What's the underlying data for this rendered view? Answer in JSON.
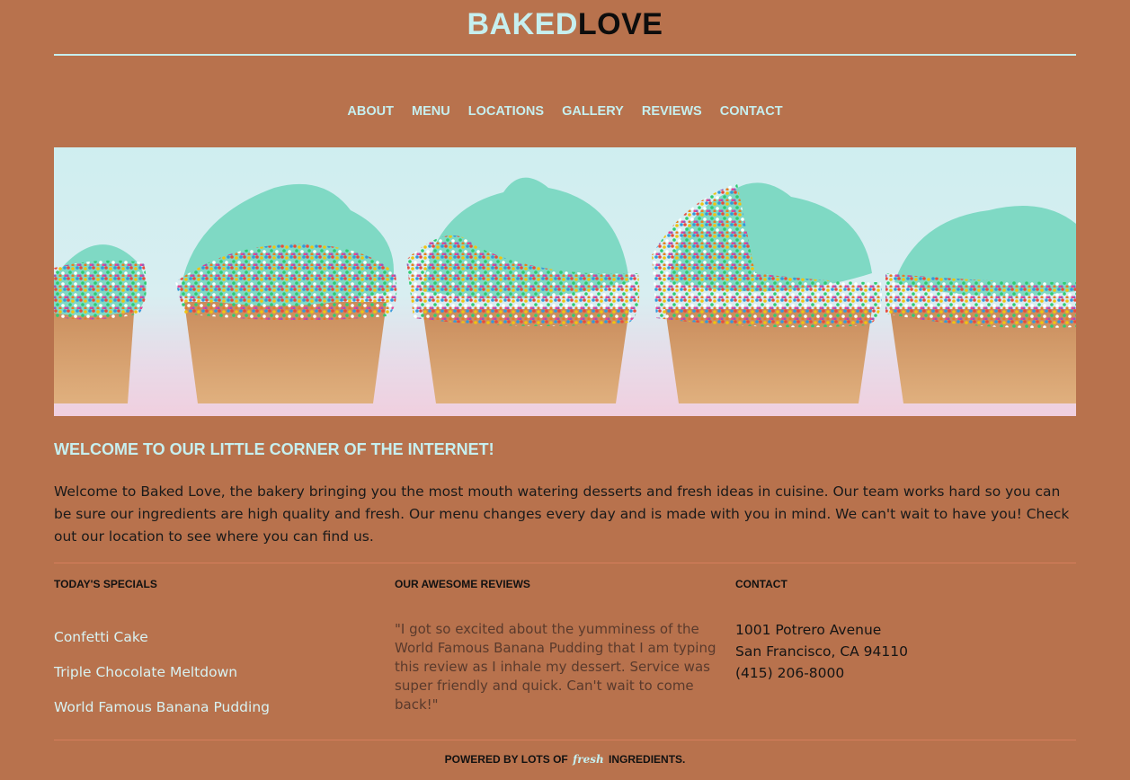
{
  "header": {
    "logo_part1": "BAKED",
    "logo_part2": "LOVE"
  },
  "nav": {
    "items": [
      "ABOUT",
      "MENU",
      "LOCATIONS",
      "GALLERY",
      "REVIEWS",
      "CONTACT"
    ]
  },
  "main": {
    "welcome_title": "WELCOME TO OUR LITTLE CORNER OF THE INTERNET!",
    "welcome_text": "Welcome to Baked Love, the bakery bringing you the most mouth watering desserts and fresh ideas in cuisine. Our team works hard so you can be sure our ingredients are high quality and fresh. Our menu changes every day and is made with you in mind. We can't wait to have you! Check out our location to see where you can find us."
  },
  "specials": {
    "title": "TODAY'S SPECIALS",
    "items": [
      "Confetti Cake",
      "Triple Chocolate Meltdown",
      "World Famous Banana Pudding"
    ]
  },
  "reviews": {
    "title": "OUR AWESOME REVIEWS",
    "text": "\"I got so excited about the yumminess of the World Famous Banana Pudding that I am typing this review as I inhale my dessert. Service was super friendly and quick. Can't wait to come back!\""
  },
  "contact": {
    "title": "CONTACT",
    "address1": "1001 Potrero Avenue",
    "address2": "San Francisco, CA 94110",
    "phone": "(415) 206-8000"
  },
  "footer": {
    "prefix": "POWERED BY LOTS OF",
    "fresh": "fresh",
    "suffix": "INGREDIENTS."
  },
  "colors": {
    "background": "#b8724d",
    "accent": "#c6efef",
    "frosting": "#7fd9c4",
    "cupcake_wrapper": "#d49a6a"
  }
}
